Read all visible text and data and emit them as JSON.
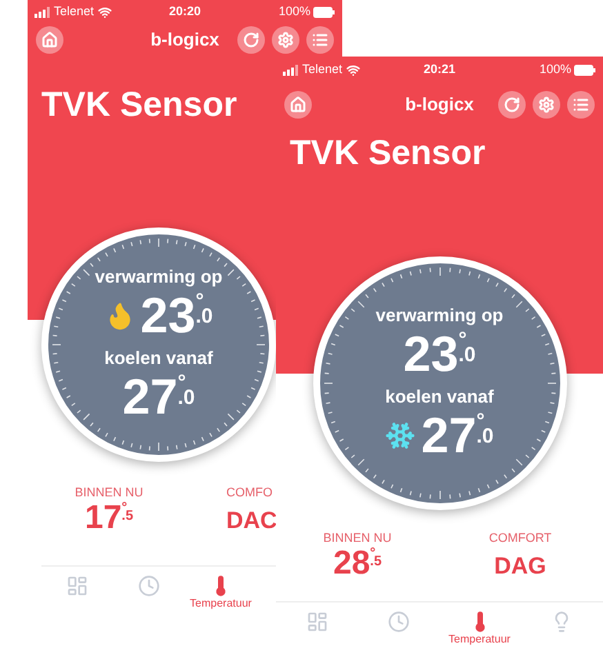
{
  "screens": [
    {
      "status_bar": {
        "carrier": "Telenet",
        "time": "20:20",
        "battery": "100%"
      },
      "header": {
        "title": "b-logicx"
      },
      "page_title": "TVK Sensor",
      "setpoints": [
        {
          "kind": "heat",
          "label": "verwarming op",
          "whole": "23",
          "unit": "°",
          "decimal": ".0",
          "active": true
        },
        {
          "kind": "cool",
          "label": "koelen vanaf",
          "whole": "27",
          "unit": "°",
          "decimal": ".0",
          "active": false
        }
      ],
      "stats": [
        {
          "kind": "temperature",
          "label": "BINNEN NU",
          "whole": "17",
          "unit": "°",
          "decimal": ".5"
        },
        {
          "kind": "text",
          "label": "COMFO",
          "value": "DAC"
        }
      ],
      "tabs": [
        {
          "kind": "floorplan",
          "selected": false
        },
        {
          "kind": "clock",
          "selected": false
        },
        {
          "kind": "thermometer",
          "label": "Temperatuur",
          "selected": true
        }
      ]
    },
    {
      "status_bar": {
        "carrier": "Telenet",
        "time": "20:21",
        "battery": "100%"
      },
      "header": {
        "title": "b-logicx"
      },
      "page_title": "TVK Sensor",
      "setpoints": [
        {
          "kind": "heat",
          "label": "verwarming op",
          "whole": "23",
          "unit": "°",
          "decimal": ".0",
          "active": false
        },
        {
          "kind": "cool",
          "label": "koelen vanaf",
          "whole": "27",
          "unit": "°",
          "decimal": ".0",
          "active": true
        }
      ],
      "stats": [
        {
          "kind": "temperature",
          "label": "BINNEN NU",
          "whole": "28",
          "unit": "°",
          "decimal": ".5"
        },
        {
          "kind": "text",
          "label": "COMFORT",
          "value": "DAG"
        }
      ],
      "tabs": [
        {
          "kind": "floorplan",
          "selected": false
        },
        {
          "kind": "clock",
          "selected": false
        },
        {
          "kind": "thermometer",
          "label": "Temperatuur",
          "selected": true
        },
        {
          "kind": "bulb",
          "selected": false
        }
      ]
    }
  ]
}
